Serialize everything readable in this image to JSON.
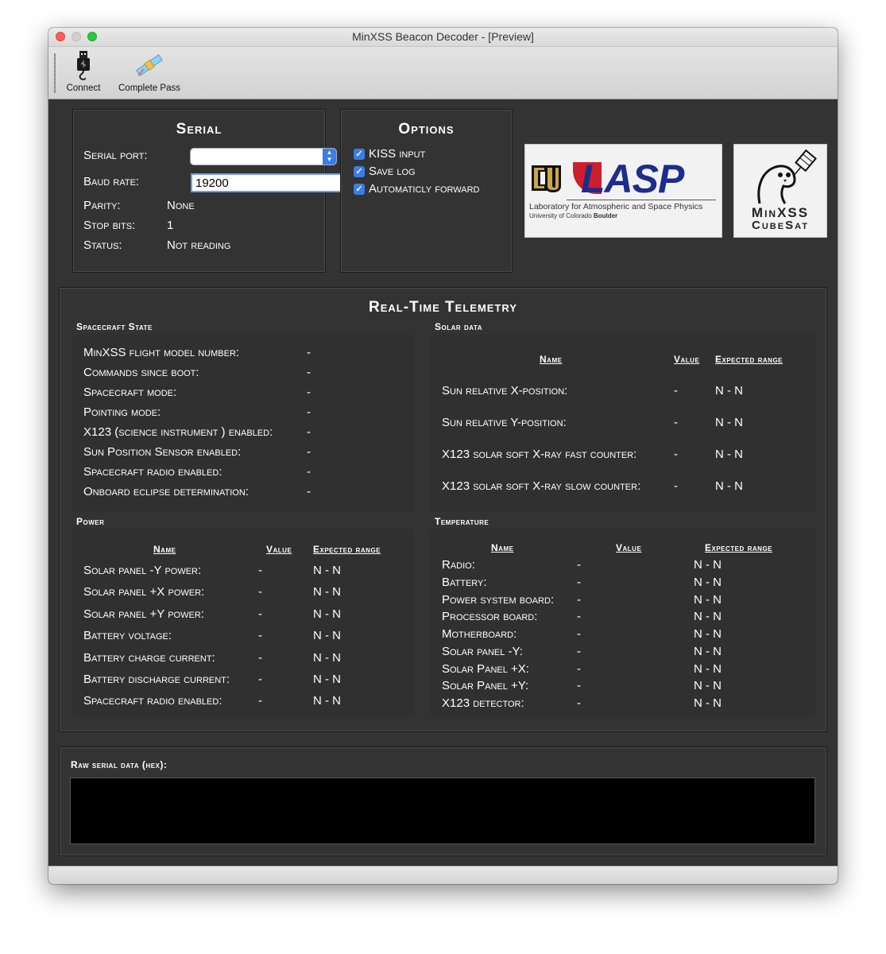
{
  "window": {
    "title": "MinXSS Beacon Decoder - [Preview]"
  },
  "toolbar": {
    "connect": "Connect",
    "complete_pass": "Complete Pass"
  },
  "serial": {
    "heading": "Serial",
    "port_label": "Serial port:",
    "port_value": "",
    "baud_label": "Baud rate:",
    "baud_value": "19200",
    "parity_label": "Parity:",
    "parity_value": "None",
    "stop_label": "Stop bits:",
    "stop_value": "1",
    "status_label": "Status:",
    "status_value": "Not reading"
  },
  "options": {
    "heading": "Options",
    "items": [
      {
        "label": "KISS input",
        "checked": true
      },
      {
        "label": "Save log",
        "checked": true
      },
      {
        "label": "Automaticly forward",
        "checked": true
      }
    ]
  },
  "logos": {
    "lasp_text": "LASP",
    "lasp_line1": "Laboratory for Atmospheric and Space Physics",
    "lasp_line2a": "University of Colorado ",
    "lasp_line2b": "Boulder",
    "minxss_line1": "MinXSS",
    "minxss_line2": "CubeSat"
  },
  "telemetry": {
    "heading": "Real-Time Telemetry",
    "spacecraft": {
      "title": "Spacecraft State",
      "rows": [
        {
          "label": "MinXSS flight model number:",
          "value": "-"
        },
        {
          "label": "Commands since boot:",
          "value": "-"
        },
        {
          "label": "Spacecraft mode:",
          "value": "-"
        },
        {
          "label": "Pointing mode:",
          "value": "-"
        },
        {
          "label": "X123 (science instrument ) enabled:",
          "value": "-"
        },
        {
          "label": "Sun Position Sensor enabled:",
          "value": "-"
        },
        {
          "label": "Spacecraft radio enabled:",
          "value": "-"
        },
        {
          "label": "Onboard eclipse determination:",
          "value": "-"
        }
      ]
    },
    "solar": {
      "title": "Solar data",
      "col_name": "Name",
      "col_value": "Value",
      "col_range": "Expected range",
      "rows": [
        {
          "label": "Sun relative X-position:",
          "value": "-",
          "range": "N - N"
        },
        {
          "label": "Sun relative Y-position:",
          "value": "-",
          "range": "N - N"
        },
        {
          "label": "X123 solar soft X-ray fast counter:",
          "value": "-",
          "range": "N - N"
        },
        {
          "label": "X123 solar soft X-ray slow counter:",
          "value": "-",
          "range": "N - N"
        }
      ]
    },
    "power": {
      "title": "Power",
      "col_name": "Name",
      "col_value": "Value",
      "col_range": "Expected range",
      "rows": [
        {
          "label": "Solar panel -Y power:",
          "value": "-",
          "range": "N - N"
        },
        {
          "label": "Solar panel +X power:",
          "value": "-",
          "range": "N - N"
        },
        {
          "label": "Solar panel +Y power:",
          "value": "-",
          "range": "N - N"
        },
        {
          "label": "Battery voltage:",
          "value": "-",
          "range": "N - N"
        },
        {
          "label": "Battery charge current:",
          "value": "-",
          "range": "N - N"
        },
        {
          "label": "Battery discharge current:",
          "value": "-",
          "range": "N - N"
        },
        {
          "label": "Spacecraft radio enabled:",
          "value": "-",
          "range": "N - N"
        }
      ]
    },
    "temperature": {
      "title": "Temperature",
      "col_name": "Name",
      "col_value": "Value",
      "col_range": "Expected range",
      "rows": [
        {
          "label": "Radio:",
          "value": "-",
          "range": "N - N"
        },
        {
          "label": "Battery:",
          "value": "-",
          "range": "N - N"
        },
        {
          "label": "Power system board:",
          "value": "-",
          "range": "N - N"
        },
        {
          "label": "Processor board:",
          "value": "-",
          "range": "N - N"
        },
        {
          "label": "Motherboard:",
          "value": "-",
          "range": "N - N"
        },
        {
          "label": "Solar panel -Y:",
          "value": "-",
          "range": "N - N"
        },
        {
          "label": "Solar Panel +X:",
          "value": "-",
          "range": "N - N"
        },
        {
          "label": "Solar Panel +Y:",
          "value": "-",
          "range": "N - N"
        },
        {
          "label": "X123 detector:",
          "value": "-",
          "range": "N - N"
        }
      ]
    }
  },
  "raw": {
    "label": "Raw serial data (hex):",
    "content": ""
  },
  "colors": {
    "window_bg": "#333333",
    "accent": "#3b7de8",
    "text": "#ffffff"
  }
}
